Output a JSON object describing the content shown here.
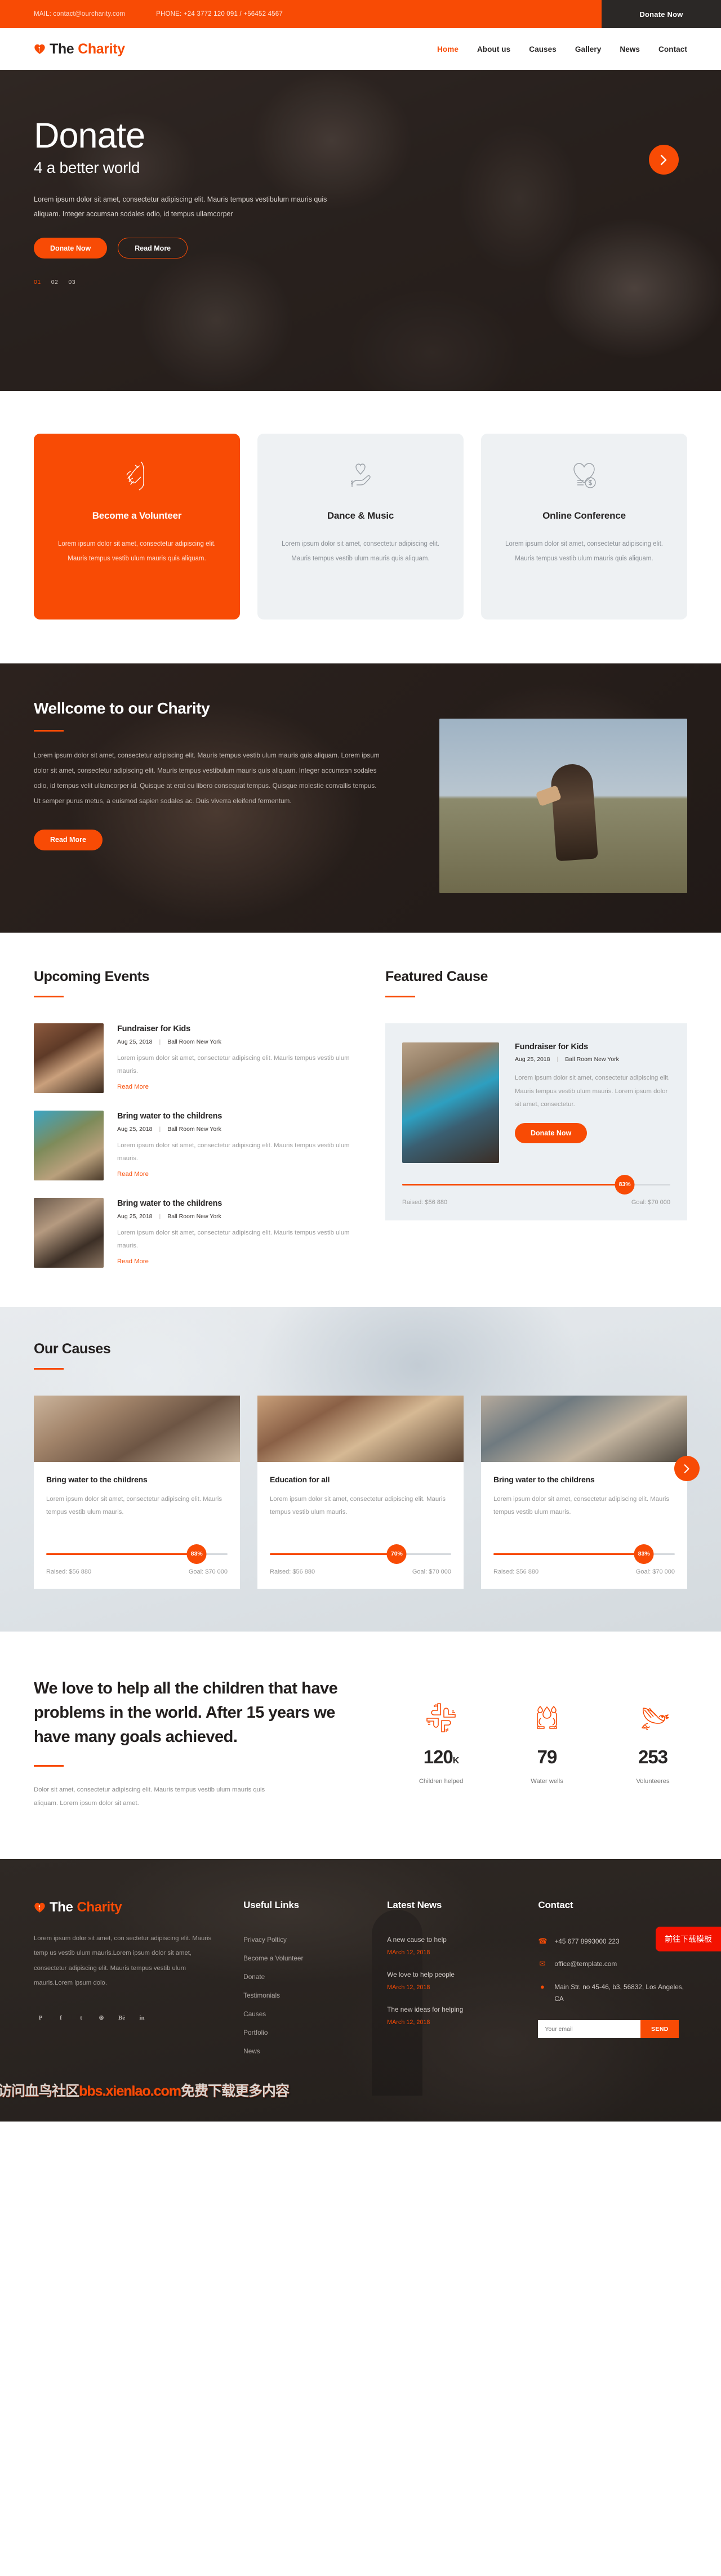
{
  "topbar": {
    "mail": "MAIL: contact@ourcharity.com",
    "phone": "PHONE: +24 3772 120 091 / +56452 4567",
    "donate_label": "Donate Now"
  },
  "brand": {
    "part1": "The",
    "part2": "Charity"
  },
  "nav": {
    "items": [
      {
        "label": "Home",
        "active": true
      },
      {
        "label": "About us",
        "active": false
      },
      {
        "label": "Causes",
        "active": false
      },
      {
        "label": "Gallery",
        "active": false
      },
      {
        "label": "News",
        "active": false
      },
      {
        "label": "Contact",
        "active": false
      }
    ]
  },
  "hero": {
    "title": "Donate",
    "subtitle": "4 a better world",
    "paragraph": "Lorem ipsum dolor sit amet, consectetur adipiscing elit. Mauris tempus vestibulum mauris quis aliquam. Integer accumsan sodales odio, id tempus ullamcorper",
    "btn_primary": "Donate Now",
    "btn_secondary": "Read More",
    "slides": [
      "01",
      "02",
      "03"
    ],
    "active_slide": "01",
    "next_icon": "chevron-right-icon"
  },
  "services": [
    {
      "icon": "helping-hands-icon",
      "title": "Become a Volunteer",
      "text": "Lorem ipsum dolor sit amet, consectetur adipiscing elit. Mauris tempus vestib ulum mauris quis aliquam.",
      "highlight": true
    },
    {
      "icon": "hand-heart-icon",
      "title": "Dance & Music",
      "text": "Lorem ipsum dolor sit amet, consectetur adipiscing elit. Mauris tempus vestib ulum mauris quis aliquam.",
      "highlight": false
    },
    {
      "icon": "heart-money-icon",
      "title": "Online Conference",
      "text": "Lorem ipsum dolor sit amet, consectetur adipiscing elit. Mauris tempus vestib ulum mauris quis aliquam.",
      "highlight": false
    }
  ],
  "welcome": {
    "title": "Wellcome to our Charity",
    "paragraph": "Lorem ipsum dolor sit amet, consectetur adipiscing elit. Mauris tempus vestib ulum mauris quis aliquam. Lorem ipsum dolor sit amet, consectetur adipiscing elit. Mauris tempus vestibulum mauris quis aliquam. Integer accumsan sodales odio, id tempus velit ullamcorper id. Quisque at erat eu libero consequat tempus. Quisque molestie convallis tempus. Ut semper purus metus, a euismod sapien sodales ac. Duis viverra eleifend fermentum.",
    "button": "Read More"
  },
  "events": {
    "title": "Upcoming Events",
    "items": [
      {
        "title": "Fundraiser for Kids",
        "date": "Aug 25, 2018",
        "place": "Ball Room New York",
        "text": "Lorem ipsum dolor sit amet, consectetur adipiscing elit. Mauris tempus vestib ulum mauris.",
        "link": "Read More"
      },
      {
        "title": "Bring water to the childrens",
        "date": "Aug 25, 2018",
        "place": "Ball Room New York",
        "text": "Lorem ipsum dolor sit amet, consectetur adipiscing elit. Mauris tempus vestib ulum mauris.",
        "link": "Read More"
      },
      {
        "title": "Bring water to the childrens",
        "date": "Aug 25, 2018",
        "place": "Ball Room New York",
        "text": "Lorem ipsum dolor sit amet, consectetur adipiscing elit. Mauris tempus vestib ulum mauris.",
        "link": "Read More"
      }
    ]
  },
  "featured": {
    "title": "Featured Cause",
    "card": {
      "title": "Fundraiser for Kids",
      "date": "Aug 25, 2018",
      "place": "Ball Room New York",
      "text": "Lorem ipsum dolor sit amet, consectetur adipiscing elit. Mauris tempus vestib ulum mauris. Lorem ipsum dolor sit amet, consectetur.",
      "button": "Donate Now",
      "percent": "83%",
      "percent_value": 83,
      "raised": "Raised: $56 880",
      "goal": "Goal: $70 000"
    }
  },
  "causes": {
    "title": "Our Causes",
    "next_icon": "chevron-right-icon",
    "items": [
      {
        "title": "Bring water to the childrens",
        "text": "Lorem ipsum dolor sit amet, consectetur adipiscing elit. Mauris tempus vestib ulum mauris.",
        "percent": "83%",
        "percent_value": 83,
        "raised": "Raised: $56 880",
        "goal": "Goal: $70 000"
      },
      {
        "title": "Education for all",
        "text": "Lorem ipsum dolor sit amet, consectetur adipiscing elit. Mauris tempus vestib ulum mauris.",
        "percent": "70%",
        "percent_value": 70,
        "raised": "Raised: $56 880",
        "goal": "Goal: $70 000"
      },
      {
        "title": "Bring water to the childrens",
        "text": "Lorem ipsum dolor sit amet, consectetur adipiscing elit. Mauris tempus vestib ulum mauris.",
        "percent": "83%",
        "percent_value": 83,
        "raised": "Raised: $56 880",
        "goal": "Goal: $70 000"
      }
    ]
  },
  "about": {
    "heading": "We love to help all the children that have problems in the world. After 15 years we have many goals achieved.",
    "paragraph": "Dolor sit amet, consectetur adipiscing elit. Mauris tempus vestib ulum mauris quis aliquam. Lorem ipsum dolor sit amet.",
    "stats": [
      {
        "icon": "teamwork-hands-icon",
        "number": "120",
        "suffix": "K",
        "label": "Children helped"
      },
      {
        "icon": "water-drop-hands-icon",
        "number": "79",
        "suffix": "",
        "label": "Water wells"
      },
      {
        "icon": "dove-icon",
        "number": "253",
        "suffix": "",
        "label": "Volunteeres"
      }
    ]
  },
  "footer": {
    "description": "Lorem ipsum dolor sit amet, con sectetur adipiscing elit. Mauris temp us vestib ulum mauris.Lorem ipsum dolor sit amet, consectetur adipiscing elit. Mauris tempus vestib ulum mauris.Lorem ipsum dolo.",
    "social": [
      {
        "icon": "pinterest-icon",
        "glyph": "P"
      },
      {
        "icon": "facebook-icon",
        "glyph": "f"
      },
      {
        "icon": "twitter-icon",
        "glyph": "t"
      },
      {
        "icon": "dribbble-icon",
        "glyph": "⊛"
      },
      {
        "icon": "behance-icon",
        "glyph": "Bē"
      },
      {
        "icon": "linkedin-icon",
        "glyph": "in"
      }
    ],
    "useful_links": {
      "title": "Useful Links",
      "items": [
        "Privacy Polticy",
        "Become a Volunteer",
        "Donate",
        "Testimonials",
        "Causes",
        "Portfolio",
        "News"
      ]
    },
    "latest_news": {
      "title": "Latest News",
      "items": [
        {
          "title": "A new cause to help",
          "date": "MArch 12, 2018"
        },
        {
          "title": "We love to help people",
          "date": "MArch 12, 2018"
        },
        {
          "title": "The new ideas for helping",
          "date": "MArch 12, 2018"
        }
      ]
    },
    "contact": {
      "title": "Contact",
      "items": [
        {
          "icon": "phone-icon",
          "glyph": "☎",
          "text": "+45 677 8993000 223"
        },
        {
          "icon": "envelope-icon",
          "glyph": "✉",
          "text": "office@template.com"
        },
        {
          "icon": "map-pin-icon",
          "glyph": "●",
          "text": "Main Str. no 45-46, b3, 56832, Los Angeles, CA"
        }
      ],
      "email_placeholder": "Your email",
      "send_label": "SEND"
    },
    "download_badge": "前往下载模板",
    "watermark_pre": "访问血鸟社区",
    "watermark_hl": "bbs.xienlao.com",
    "watermark_post": "免费下载更多内容"
  },
  "colors": {
    "accent": "#f84b05",
    "dark": "#2b2826",
    "light_panel": "#eef1f3"
  }
}
